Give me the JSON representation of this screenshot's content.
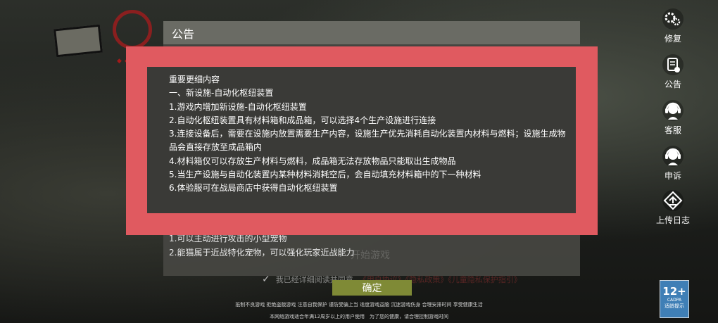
{
  "dialog": {
    "title": "公告",
    "lower_lines": [
      "1.可以主动进行攻击的小型宠物",
      "2.能猫属于近战特化宠物，可以强化玩家近战能力"
    ],
    "ghost_text": "开始游戏",
    "agree_text": "我已经详细阅读并同意",
    "agree_link": "《用户协议》《隐私政策》《儿童隐私保护指引》",
    "confirm_label": "确定"
  },
  "notice": {
    "lines": [
      "重要更细内容",
      "一、新设施-自动化枢纽装置",
      "1.游戏内增加新设施-自动化枢纽装置",
      "2.自动化枢纽装置具有材料箱和成品箱，可以选择4个生产设施进行连接",
      "3.连接设备后，需要在设施内放置需要生产内容，设施生产优先消耗自动化装置内材料与燃料；设施生成物品会直接存放至成品箱内",
      "4.材料箱仅可以存放生产材料与燃料，成品箱无法存放物品只能取出生成物品",
      "5.当生产设施与自动化装置内某种材料消耗空后，会自动填充材料箱中的下一种材料",
      "6.体验服可在战局商店中获得自动化枢纽装置"
    ]
  },
  "sidebar": {
    "items": [
      {
        "icon": "gear-icon",
        "label": "修复"
      },
      {
        "icon": "notice-icon",
        "label": "公告"
      },
      {
        "icon": "headset-icon",
        "label": "客服"
      },
      {
        "icon": "headset-complaint-icon",
        "label": "申诉"
      },
      {
        "icon": "upload-icon",
        "label": "上传日志"
      }
    ]
  },
  "footer": {
    "line1": "抵制不良游戏 拒绝盗版游戏 注意自我保护 谨防受骗上当 适度游戏益脑 沉迷游戏伤身 合理安排时间 享受健康生活",
    "line2": "本网络游戏适合年满12周岁以上的用户使用　为了您的健康，请合理控制游戏时间"
  },
  "age_rating": {
    "number": "12+",
    "org": "CADPA",
    "caption": "适龄提示"
  },
  "colors": {
    "highlight": "#e05a60",
    "confirm": "#7f8a36",
    "age_badge": "#3f7fb6"
  }
}
